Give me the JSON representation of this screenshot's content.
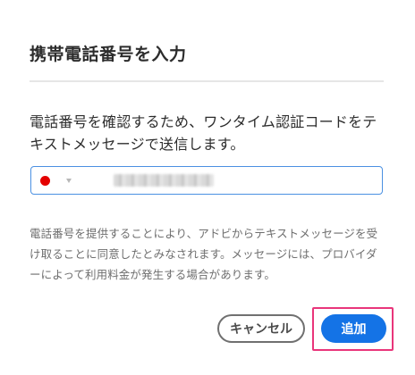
{
  "dialog": {
    "title": "携帯電話番号を入力",
    "description": "電話番号を確認するため、ワンタイム認証コードをテキストメッセージで送信します。",
    "phone_field": {
      "country_flag": "japan-flag-icon",
      "value": "",
      "placeholder": ""
    },
    "legal_text": "電話番号を提供することにより、アドビからテキストメッセージを受け取ることに同意したとみなされます。メッセージには、プロバイダーによって利用料金が発生する場合があります。",
    "buttons": {
      "cancel_label": "キャンセル",
      "add_label": "追加"
    }
  },
  "colors": {
    "accent": "#1473e6",
    "field_border": "#4a90e2",
    "highlight": "#e9357a",
    "flag_red": "#e40000"
  }
}
